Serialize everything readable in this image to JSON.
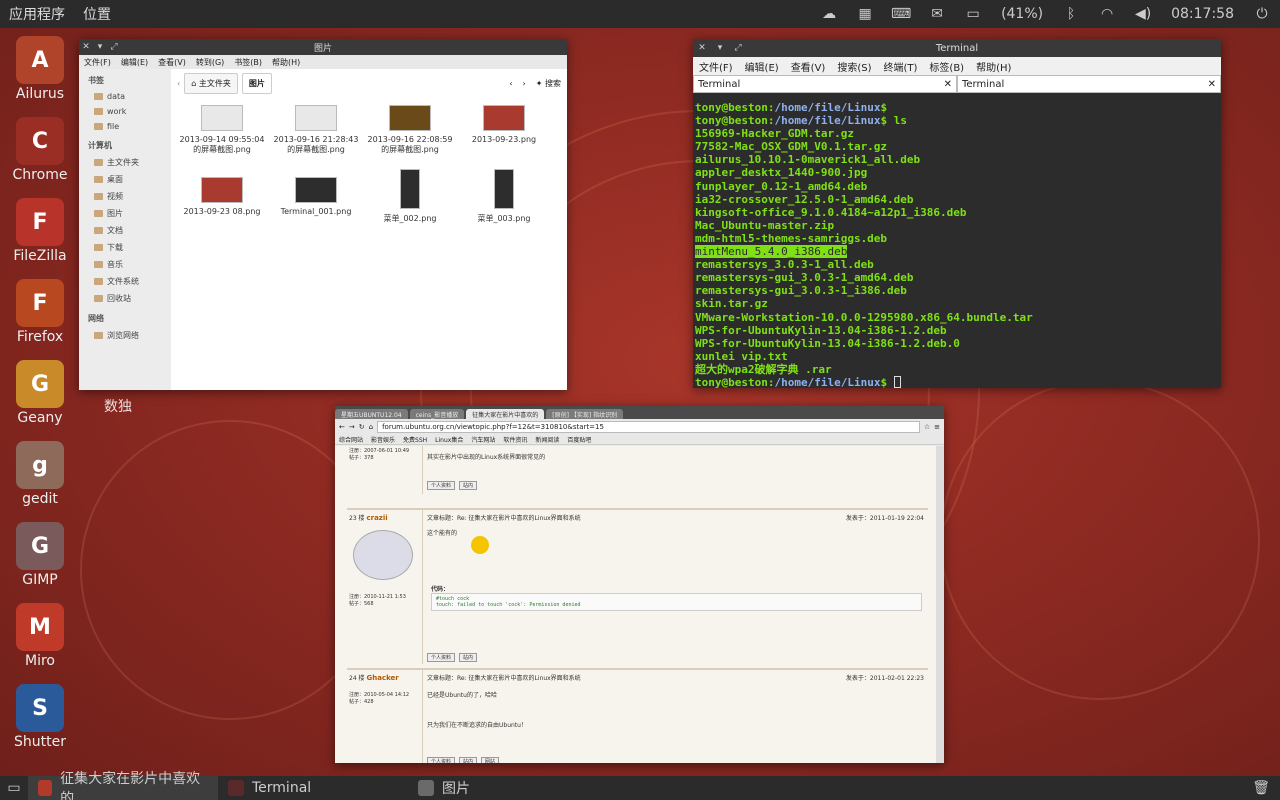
{
  "top_panel": {
    "menus": [
      "应用程序",
      "位置"
    ],
    "battery": "(41%)",
    "clock": "08:17:58",
    "indicators": [
      "network-weather-icon",
      "calendar-icon",
      "keyboard-icon",
      "mail-icon",
      "battery-icon",
      "bluetooth-icon",
      "wifi-icon",
      "volume-icon"
    ]
  },
  "dock": {
    "items": [
      {
        "label": "Ailurus",
        "icon": "red-panda-icon",
        "color": "#b0442a"
      },
      {
        "label": "Chrome",
        "icon": "chrome-icon",
        "color": "#9a2e25"
      },
      {
        "label": "FileZilla",
        "icon": "filezilla-icon",
        "color": "#b8342a"
      },
      {
        "label": "Firefox",
        "icon": "firefox-icon",
        "color": "#b8481f"
      },
      {
        "label": "Geany",
        "icon": "geany-icon",
        "color": "#c98a2a"
      },
      {
        "label": "gedit",
        "icon": "gedit-icon",
        "color": "#8d6a5a"
      },
      {
        "label": "GIMP",
        "icon": "gimp-icon",
        "color": "#7a5a5a"
      },
      {
        "label": "Miro",
        "icon": "miro-icon",
        "color": "#c03a2a"
      },
      {
        "label": "Shutter",
        "icon": "shutter-icon",
        "color": "#2a5a9a"
      }
    ],
    "desktop_label": "数独"
  },
  "file_manager": {
    "title": "图片",
    "menus": [
      "文件(F)",
      "编辑(E)",
      "查看(V)",
      "转到(G)",
      "书签(B)",
      "帮助(H)"
    ],
    "sidebar": {
      "bookmarks_heading": "书签",
      "bookmarks": [
        "data",
        "work",
        "file"
      ],
      "computer_heading": "计算机",
      "computer": [
        "主文件夹",
        "桌面",
        "视频",
        "图片",
        "文档",
        "下载",
        "音乐",
        "文件系统",
        "回收站"
      ],
      "network_heading": "网络",
      "network": [
        "浏览网络"
      ]
    },
    "path": {
      "home": "主文件夹",
      "current": "图片",
      "search": "搜索"
    },
    "files": [
      {
        "name": "2013-09-14 09:55:04\n的屏幕截图.png",
        "thumb": "light"
      },
      {
        "name": "2013-09-16 21:28:43\n的屏幕截图.png",
        "thumb": "light"
      },
      {
        "name": "2013-09-16 22:08:59\n的屏幕截图.png",
        "thumb": "brown"
      },
      {
        "name": "2013-09-23.png",
        "thumb": "red"
      },
      {
        "name": "2013-09-23 08.png",
        "thumb": "red"
      },
      {
        "name": "Terminal_001.png",
        "thumb": "dark"
      },
      {
        "name": "菜单_002.png",
        "thumb": "tall"
      },
      {
        "name": "菜单_003.png",
        "thumb": "tall"
      }
    ]
  },
  "terminal": {
    "title": "Terminal",
    "menus": [
      "文件(F)",
      "编辑(E)",
      "查看(V)",
      "搜索(S)",
      "终端(T)",
      "标签(B)",
      "帮助(H)"
    ],
    "tabs": [
      "Terminal",
      "Terminal"
    ],
    "prompt_user": "tony@beston",
    "prompt_path": "/home/file/Linux",
    "command": "ls",
    "files": [
      "156969-Hacker_GDM.tar.gz",
      "77582-Mac_OSX_GDM_V0.1.tar.gz",
      "ailurus_10.10.1-0maverick1_all.deb",
      "appler_desktx_1440-900.jpg",
      "funplayer_0.12-1_amd64.deb",
      "ia32-crossover_12.5.0-1_amd64.deb",
      "kingsoft-office_9.1.0.4184~a12p1_i386.deb",
      "Mac_Ubuntu-master.zip",
      "mdm-html5-themes-samriggs.deb",
      "mintMenu_5.4.0_i386.deb",
      "remastersys_3.0.3-1_all.deb",
      "remastersys-gui_3.0.3-1_amd64.deb",
      "remastersys-gui_3.0.3-1_i386.deb",
      "skin.tar.gz",
      "VMware-Workstation-10.0.0-1295980.x86_64.bundle.tar",
      "WPS-for-UbuntuKylin-13.04-i386-1.2.deb",
      "WPS-for-UbuntuKylin-13.04-i386-1.2.deb.0",
      "xunlei vip.txt",
      "超大的wpa2破解字典 .rar"
    ],
    "highlighted_index": 9
  },
  "browser": {
    "tabs": [
      "星期五UBUNTU12.04",
      "ceins_影音播放",
      "征集大家在影片中喜欢的",
      "[原创] 【实现] 指纹识别"
    ],
    "active_tab": 2,
    "url": "forum.ubuntu.org.cn/viewtopic.php?f=12&t=310810&start=15",
    "bookmarks": [
      "综合网站",
      "影音娱乐",
      "免费SSH",
      "Linux集合",
      "汽车网站",
      "软件资讯",
      "新闻阅读",
      "百度贴吧"
    ],
    "posts": [
      {
        "floor": "",
        "user": "",
        "date": "",
        "joined": "注册：2007-06-01 10:49",
        "posts_count": "帖子：378",
        "body": "其实在影片中出现的Linux系统界面很常见的",
        "code": ""
      },
      {
        "floor": "23 楼",
        "user": "crazii",
        "date": "发表于：2011-01-19 22:04",
        "joined": "注册：2010-11-21 1:53",
        "posts_count": "帖子：568",
        "title": "文章标题：Re: 征集大家在影片中喜欢的Linux界面和系统",
        "body": "这个能有的",
        "code_label": "代码：",
        "code": "#touch cock\ntouch: failed to touch 'cock': Permission denied"
      },
      {
        "floor": "24 楼",
        "user": "Ghacker",
        "date": "发表于：2011-02-01 22:23",
        "joined": "注册：2010-05-04 14:12",
        "posts_count": "帖子：428",
        "title": "文章标题：Re: 征集大家在影片中喜欢的Linux界面和系统",
        "body": "已经是Ubuntu的了，哈哈",
        "signature": "只为我们在不断追求的自由Ubuntu！",
        "code": ""
      }
    ],
    "buttons": [
      "个人资料",
      "站内",
      "网站"
    ]
  },
  "taskbar": {
    "tasks": [
      {
        "label": "征集大家在影片中喜欢的...",
        "icon": "chrome-icon",
        "active": true
      },
      {
        "label": "Terminal",
        "icon": "terminal-icon",
        "active": false
      },
      {
        "label": "图片",
        "icon": "folder-icon",
        "active": false
      }
    ]
  }
}
